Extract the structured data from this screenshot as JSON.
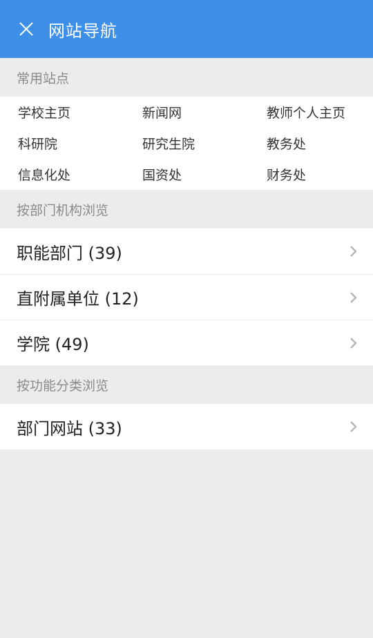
{
  "header": {
    "title": "网站导航",
    "close_icon": "close-icon",
    "background": "#3d8fe8"
  },
  "common_sites": {
    "title": "常用站点",
    "links": [
      {
        "label": "学校主页"
      },
      {
        "label": "新闻网"
      },
      {
        "label": "教师个人主页"
      },
      {
        "label": "科研院"
      },
      {
        "label": "研究生院"
      },
      {
        "label": "教务处"
      },
      {
        "label": "信息化处"
      },
      {
        "label": "国资处"
      },
      {
        "label": "财务处"
      }
    ]
  },
  "by_department": {
    "title": "按部门机构浏览",
    "items": [
      {
        "label": "职能部门 (39)",
        "icon": "chevron-right-icon"
      },
      {
        "label": "直附属单位 (12)",
        "icon": "chevron-right-icon"
      },
      {
        "label": "学院 (49)",
        "icon": "chevron-right-icon"
      }
    ]
  },
  "by_function": {
    "title": "按功能分类浏览",
    "items": [
      {
        "label": "部门网站 (33)",
        "icon": "chevron-right-icon"
      }
    ]
  }
}
